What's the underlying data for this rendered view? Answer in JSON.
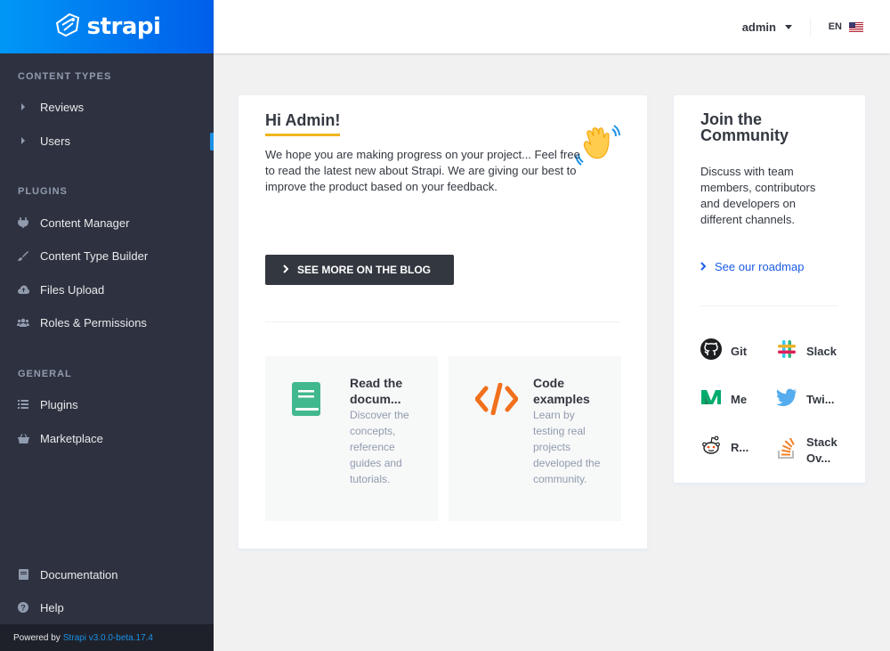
{
  "brand": {
    "name": "strapi"
  },
  "sidebar": {
    "content_types_title": "Content Types",
    "content_types": [
      {
        "label": "Reviews",
        "icon": "caret-right-icon"
      },
      {
        "label": "Users",
        "icon": "caret-right-icon",
        "active": true
      }
    ],
    "plugins_title": "Plugins",
    "plugins": [
      {
        "label": "Content Manager",
        "icon": "plug-icon"
      },
      {
        "label": "Content Type Builder",
        "icon": "paint-brush-icon"
      },
      {
        "label": "Files Upload",
        "icon": "cloud-upload-icon"
      },
      {
        "label": "Roles & Permissions",
        "icon": "users-icon"
      }
    ],
    "general_title": "General",
    "general": [
      {
        "label": "Plugins",
        "icon": "list-icon"
      },
      {
        "label": "Marketplace",
        "icon": "shopping-basket-icon"
      }
    ],
    "footer_links": [
      {
        "label": "Documentation",
        "icon": "book-icon"
      },
      {
        "label": "Help",
        "icon": "question-circle-icon"
      }
    ],
    "powered_by": "Powered by",
    "version": "Strapi v3.0.0-beta.17.4"
  },
  "header": {
    "user": "admin",
    "language": "EN"
  },
  "welcome": {
    "title": "Hi Admin!",
    "text": "We hope you are making progress on your project... Feel free to read the latest new about Strapi. We are giving our best to improve the product based on your feedback.",
    "blog_button": "SEE MORE ON THE BLOG",
    "tiles": [
      {
        "title": "Read the docum...",
        "desc": "Discover the concepts, reference guides and tutorials.",
        "icon": "book-icon"
      },
      {
        "title": "Code examples",
        "desc": "Learn by testing real projects developed the community.",
        "icon": "code-icon"
      }
    ]
  },
  "community": {
    "title": "Join the Community",
    "text": "Discuss with team members, contributors and developers on different channels.",
    "roadmap": "See our roadmap",
    "links": [
      {
        "label": "Git",
        "icon": "github-icon"
      },
      {
        "label": "Slack",
        "icon": "slack-icon"
      },
      {
        "label": "Me",
        "icon": "medium-icon"
      },
      {
        "label": "Twi...",
        "icon": "twitter-icon"
      },
      {
        "label": "R...",
        "icon": "reddit-icon"
      },
      {
        "label": "Stack Ov...",
        "icon": "stackoverflow-icon"
      }
    ]
  },
  "colors": {
    "sidebar_bg": "#2e3240",
    "brand_gradient_start": "#0097f6",
    "brand_gradient_end": "#005eea",
    "accent_blue": "#1c91e7",
    "title_underline": "#f0b41e",
    "tile_bg": "#f7f8f8"
  }
}
